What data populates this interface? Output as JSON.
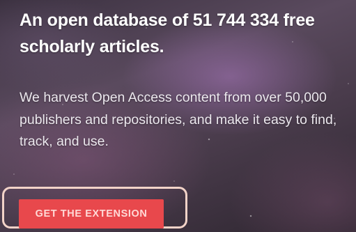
{
  "hero": {
    "headline": "An open database of 51 744 334 free scholarly articles.",
    "description": "We harvest Open Access content from over 50,000 publishers and repositories, and make it easy to find, track, and use.",
    "cta_label": "GET THE EXTENSION"
  },
  "colors": {
    "cta_background": "#e8484c",
    "highlight_outline": "#f2d3c8",
    "text": "#ffffff"
  }
}
